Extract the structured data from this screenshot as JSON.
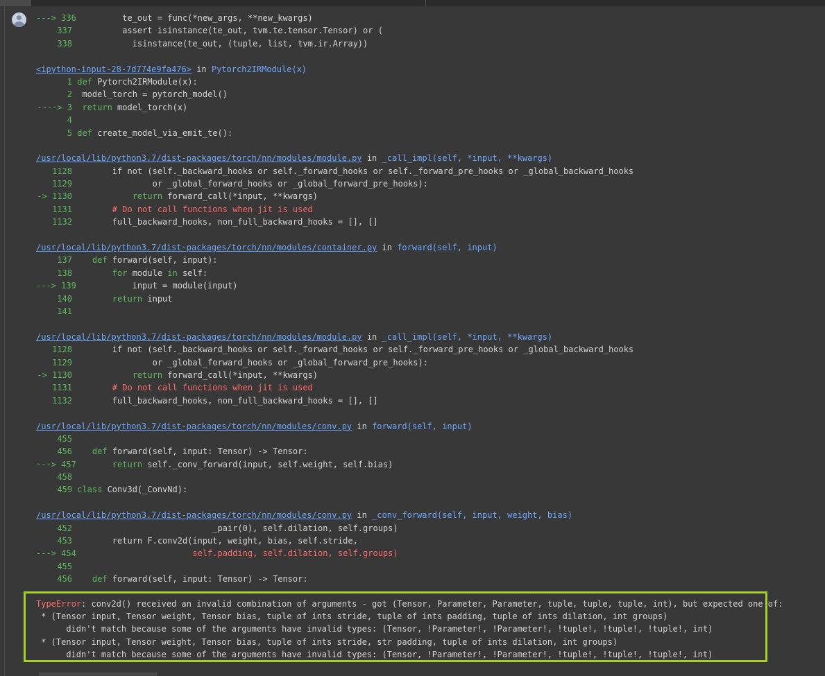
{
  "traceback": [
    {
      "type": "code",
      "gutter": "--->",
      "num": "336",
      "indent": 9,
      "tokens": [
        {
          "t": "te_out = func(*new_args, **new_kwargs)"
        }
      ]
    },
    {
      "type": "code",
      "gutter": "",
      "num": "337",
      "indent": 9,
      "tokens": [
        {
          "t": "assert isinstance(te_out, tvm.te.tensor.Tensor) or ("
        }
      ]
    },
    {
      "type": "code",
      "gutter": "",
      "num": "338",
      "indent": 11,
      "tokens": [
        {
          "t": "isinstance(te_out, (tuple, list, tvm.ir.Array))"
        }
      ]
    },
    {
      "type": "blank"
    },
    {
      "type": "header",
      "file": "<ipython-input-28-7d774e9fa476>",
      "in": " in ",
      "func": "Pytorch2IRModule(x)"
    },
    {
      "type": "code",
      "gutter": "",
      "num": "1",
      "indent": 0,
      "tokens": [
        {
          "t": "def",
          "k": "kw"
        },
        {
          "t": " Pytorch2IRModule(x):"
        }
      ]
    },
    {
      "type": "code",
      "gutter": "",
      "num": "2",
      "indent": 1,
      "tokens": [
        {
          "t": "model_torch = pytorch_model()"
        }
      ]
    },
    {
      "type": "code",
      "gutter": "---->",
      "num": "3",
      "indent": 1,
      "tokens": [
        {
          "t": "return",
          "k": "kw"
        },
        {
          "t": " model_torch(x)"
        }
      ]
    },
    {
      "type": "code",
      "gutter": "",
      "num": "4",
      "indent": 0,
      "tokens": []
    },
    {
      "type": "code",
      "gutter": "",
      "num": "5",
      "indent": 0,
      "tokens": [
        {
          "t": "def",
          "k": "kw"
        },
        {
          "t": " create_model_via_emit_te():"
        }
      ]
    },
    {
      "type": "blank"
    },
    {
      "type": "header",
      "file": "/usr/local/lib/python3.7/dist-packages/torch/nn/modules/module.py",
      "in": " in ",
      "func": "_call_impl(self, *input, **kwargs)"
    },
    {
      "type": "code",
      "gutter": "",
      "num": "1128",
      "indent": 7,
      "tokens": [
        {
          "t": "if not (self._backward_hooks or self._forward_hooks or self._forward_pre_hooks or _global_backward_hooks"
        }
      ]
    },
    {
      "type": "code",
      "gutter": "",
      "num": "1129",
      "indent": 15,
      "tokens": [
        {
          "t": "or _global_forward_hooks or _global_forward_pre_hooks):"
        }
      ]
    },
    {
      "type": "code",
      "gutter": "->",
      "num": "1130",
      "indent": 11,
      "tokens": [
        {
          "t": "return",
          "k": "kw"
        },
        {
          "t": " forward_call(*input, **kwargs)"
        }
      ]
    },
    {
      "type": "code",
      "gutter": "",
      "num": "1131",
      "indent": 7,
      "tokens": [
        {
          "t": "# Do not call functions when jit is used",
          "k": "comment"
        }
      ]
    },
    {
      "type": "code",
      "gutter": "",
      "num": "1132",
      "indent": 7,
      "tokens": [
        {
          "t": "full_backward_hooks, non_full_backward_hooks = [], []"
        }
      ]
    },
    {
      "type": "blank"
    },
    {
      "type": "header",
      "file": "/usr/local/lib/python3.7/dist-packages/torch/nn/modules/container.py",
      "in": " in ",
      "func": "forward(self, input)"
    },
    {
      "type": "code",
      "gutter": "",
      "num": "137",
      "indent": 3,
      "tokens": [
        {
          "t": "def",
          "k": "kw"
        },
        {
          "t": " forward(self, input):"
        }
      ]
    },
    {
      "type": "code",
      "gutter": "",
      "num": "138",
      "indent": 7,
      "tokens": [
        {
          "t": "for",
          "k": "kw"
        },
        {
          "t": " module "
        },
        {
          "t": "in",
          "k": "kw"
        },
        {
          "t": " self:"
        }
      ]
    },
    {
      "type": "code",
      "gutter": "--->",
      "num": "139",
      "indent": 11,
      "tokens": [
        {
          "t": "input = module(input)"
        }
      ]
    },
    {
      "type": "code",
      "gutter": "",
      "num": "140",
      "indent": 7,
      "tokens": [
        {
          "t": "return",
          "k": "kw"
        },
        {
          "t": " input"
        }
      ]
    },
    {
      "type": "code",
      "gutter": "",
      "num": "141",
      "indent": 0,
      "tokens": []
    },
    {
      "type": "blank"
    },
    {
      "type": "header",
      "file": "/usr/local/lib/python3.7/dist-packages/torch/nn/modules/module.py",
      "in": " in ",
      "func": "_call_impl(self, *input, **kwargs)"
    },
    {
      "type": "code",
      "gutter": "",
      "num": "1128",
      "indent": 7,
      "tokens": [
        {
          "t": "if not (self._backward_hooks or self._forward_hooks or self._forward_pre_hooks or _global_backward_hooks"
        }
      ]
    },
    {
      "type": "code",
      "gutter": "",
      "num": "1129",
      "indent": 15,
      "tokens": [
        {
          "t": "or _global_forward_hooks or _global_forward_pre_hooks):"
        }
      ]
    },
    {
      "type": "code",
      "gutter": "->",
      "num": "1130",
      "indent": 11,
      "tokens": [
        {
          "t": "return",
          "k": "kw"
        },
        {
          "t": " forward_call(*input, **kwargs)"
        }
      ]
    },
    {
      "type": "code",
      "gutter": "",
      "num": "1131",
      "indent": 7,
      "tokens": [
        {
          "t": "# Do not call functions when jit is used",
          "k": "comment"
        }
      ]
    },
    {
      "type": "code",
      "gutter": "",
      "num": "1132",
      "indent": 7,
      "tokens": [
        {
          "t": "full_backward_hooks, non_full_backward_hooks = [], []"
        }
      ]
    },
    {
      "type": "blank"
    },
    {
      "type": "header",
      "file": "/usr/local/lib/python3.7/dist-packages/torch/nn/modules/conv.py",
      "in": " in ",
      "func": "forward(self, input)"
    },
    {
      "type": "code",
      "gutter": "",
      "num": "455",
      "indent": 0,
      "tokens": []
    },
    {
      "type": "code",
      "gutter": "",
      "num": "456",
      "indent": 3,
      "tokens": [
        {
          "t": "def",
          "k": "kw"
        },
        {
          "t": " forward(self, input: Tensor) -> Tensor:"
        }
      ]
    },
    {
      "type": "code",
      "gutter": "--->",
      "num": "457",
      "indent": 7,
      "tokens": [
        {
          "t": "return",
          "k": "kw"
        },
        {
          "t": " self._conv_forward(input, self.weight, self.bias)"
        }
      ]
    },
    {
      "type": "code",
      "gutter": "",
      "num": "458",
      "indent": 0,
      "tokens": []
    },
    {
      "type": "code",
      "gutter": "",
      "num": "459",
      "indent": 0,
      "tokens": [
        {
          "t": "class",
          "k": "kw"
        },
        {
          "t": " Conv3d(_ConvNd):"
        }
      ]
    },
    {
      "type": "blank"
    },
    {
      "type": "header",
      "file": "/usr/local/lib/python3.7/dist-packages/torch/nn/modules/conv.py",
      "in": " in ",
      "func": "_conv_forward(self, input, weight, bias)"
    },
    {
      "type": "code",
      "gutter": "",
      "num": "452",
      "indent": 27,
      "tokens": [
        {
          "t": "_pair(0), self.dilation, self.groups)"
        }
      ]
    },
    {
      "type": "code",
      "gutter": "",
      "num": "453",
      "indent": 7,
      "tokens": [
        {
          "t": "return F.conv2d(input, weight, bias, self.stride,"
        }
      ]
    },
    {
      "type": "code",
      "gutter": "--->",
      "num": "454",
      "indent": 23,
      "tokens": [
        {
          "t": "self.padding, self.dilation, self.groups)",
          "k": "comment"
        }
      ]
    },
    {
      "type": "code",
      "gutter": "",
      "num": "455",
      "indent": 0,
      "tokens": []
    },
    {
      "type": "code",
      "gutter": "",
      "num": "456",
      "indent": 3,
      "tokens": [
        {
          "t": "def",
          "k": "kw"
        },
        {
          "t": " forward(self, input: Tensor) -> Tensor:"
        }
      ]
    }
  ],
  "error": {
    "type": "TypeError",
    "lines": [
      ": conv2d() received an invalid combination of arguments - got (Tensor, Parameter, Parameter, tuple, tuple, tuple, int), but expected one of:",
      " * (Tensor input, Tensor weight, Tensor bias, tuple of ints stride, tuple of ints padding, tuple of ints dilation, int groups)",
      "      didn't match because some of the arguments have invalid types: (Tensor, !Parameter!, !Parameter!, !tuple!, !tuple!, !tuple!, int)",
      " * (Tensor input, Tensor weight, Tensor bias, tuple of ints stride, str padding, tuple of ints dilation, int groups)",
      "      didn't match because some of the arguments have invalid types: (Tensor, !Parameter!, !Parameter!, !tuple!, !tuple!, !tuple!, int)"
    ]
  }
}
